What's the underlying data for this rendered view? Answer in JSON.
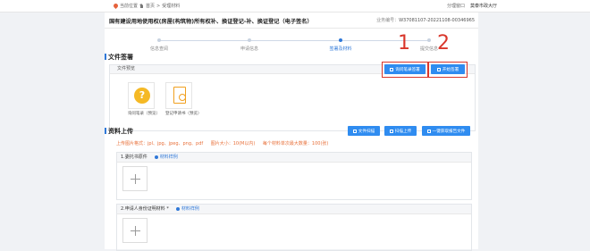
{
  "topbar": {
    "location_label": "当前位置",
    "home": "首页",
    "separator": ">",
    "current": "受理材料",
    "hall_label": "分理窗口",
    "hall_value": "莫泰市政大厅"
  },
  "header": {
    "title": "国有建设用地使用权(房屋(构筑物)所有权补、换证登记-补、换证登记（电子签名）",
    "business_no_label": "业务编号：",
    "business_no": "W37081107-20221108-00346965"
  },
  "steps": [
    {
      "label": "信息查阅",
      "active": false
    },
    {
      "label": "申请信息",
      "active": false
    },
    {
      "label": "签署及材料",
      "active": true
    },
    {
      "label": "提交信息",
      "active": false
    }
  ],
  "file_sign": {
    "section_title": "文件签署",
    "panel_title": "文件预览",
    "btn_sign": "询问笔录签署",
    "btn_start": "开始签署",
    "marker_1": "1",
    "marker_2": "2",
    "files": [
      {
        "label": "询问笔录（预览）",
        "icon": "question-icon"
      },
      {
        "label": "登记申请书（预览）",
        "icon": "document-icon"
      }
    ]
  },
  "upload": {
    "section_title": "资料上传",
    "btn_scan_file": "文件扫描",
    "btn_scan_upload": "扫描上传",
    "btn_one_click": "一键获取报告文件",
    "hints": [
      "上传图片格式：jpl、jpg、jpeg、png、pdf",
      "图片大小：10(M以内)",
      "每个材料单次最大数量：100(张)"
    ],
    "materials": [
      {
        "label": "1.委托书原件",
        "link": "材料样例"
      },
      {
        "label": "2.申请人身份证明材料 *",
        "link": "材料样例"
      }
    ]
  }
}
